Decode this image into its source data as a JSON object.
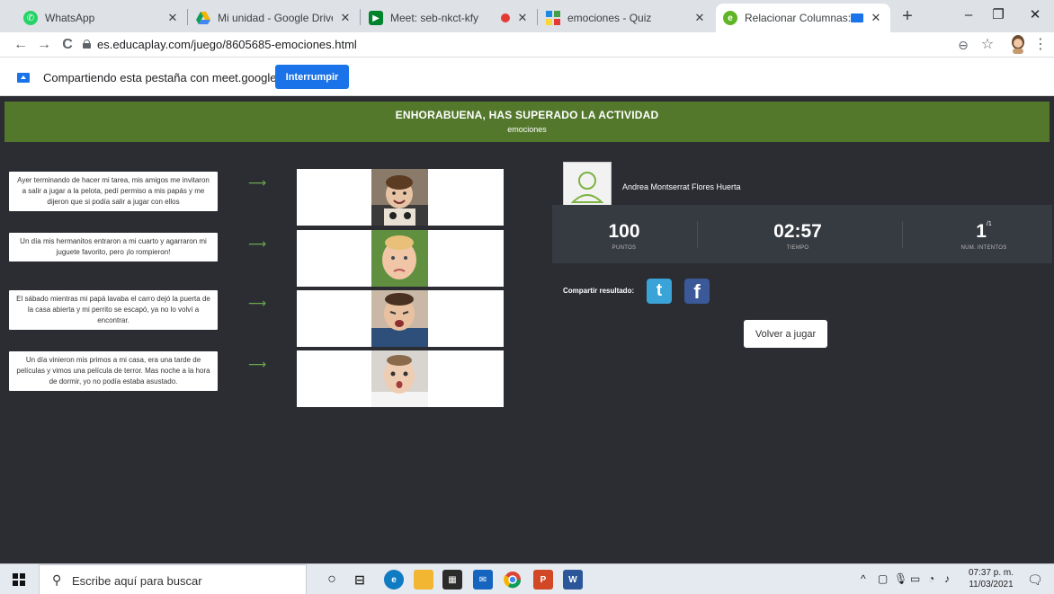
{
  "browser": {
    "tabs": [
      {
        "title": "WhatsApp",
        "icon": "whatsapp-icon",
        "color": "#25d366"
      },
      {
        "title": "Mi unidad - Google Drive",
        "icon": "google-drive-icon",
        "color": "#f4b400"
      },
      {
        "title": "Meet: seb-nkct-kfy",
        "icon": "google-meet-icon",
        "color": "#00832d"
      },
      {
        "title": "emociones - Quiz",
        "icon": "quiz-icon",
        "color": "#3b5998"
      },
      {
        "title": "Relacionar Columnas: emc",
        "icon": "educaplay-icon",
        "color": "#5fb526",
        "active": true
      }
    ],
    "new_tab": "+",
    "window": {
      "minimize": "–",
      "maximize": "❐",
      "close": "✕"
    },
    "nav": {
      "back": "←",
      "forward": "→",
      "reload": "C"
    },
    "url": "es.educaplay.com/juego/8605685-emociones.html",
    "zoom_icon": "⊖",
    "star_icon": "☆",
    "menu_icon": "⋮"
  },
  "sharebar": {
    "text": "Compartiendo esta pestaña con meet.google.com",
    "stop_label": "Interrumpir"
  },
  "activity": {
    "banner_title": "ENHORABUENA, HAS SUPERADO LA ACTIVIDAD",
    "banner_subtitle": "emociones",
    "rows": [
      {
        "statement": "Ayer terminando de hacer mi tarea, mis amigos me invitaron a salir a jugar a la pelota, pedí permiso a mis papás y me dijeron que si podía salir a jugar con ellos",
        "arrow": "⟶",
        "photo": "baby-happy"
      },
      {
        "statement": "Un día mis hermanitos entraron a mi cuarto y agarraron mi juguete favorito, pero ¡lo rompieron!",
        "arrow": "⟶",
        "photo": "baby-sad"
      },
      {
        "statement": "El sábado mientras mi papá lavaba el carro dejó la puerta de la casa abierta y mi perrito se escapó, ya no lo volví a encontrar.",
        "arrow": "⟶",
        "photo": "baby-crying"
      },
      {
        "statement": "Un día vinieron mis primos a mi casa, era una tarde de películas y vimos una película de terror. Mas noche a la hora de dormir, yo no podía estaba asustado.",
        "arrow": "⟶",
        "photo": "baby-scared"
      }
    ],
    "user_name": "Andrea Montserrat Flores Huerta",
    "stats": {
      "points_value": "100",
      "points_label": "PUNTOS",
      "time_value": "02:57",
      "time_label": "TIEMPO",
      "attempts_value": "1",
      "attempts_total": "/1",
      "attempts_label": "NUM. INTENTOS"
    },
    "share_label": "Compartir resultado:",
    "twitter": "t",
    "facebook": "f",
    "replay_label": "Volver a jugar"
  },
  "taskbar": {
    "search_placeholder": "Escribe aquí para buscar",
    "time": "07:37 p. m.",
    "date": "11/03/2021",
    "tray_chevron": "^"
  }
}
